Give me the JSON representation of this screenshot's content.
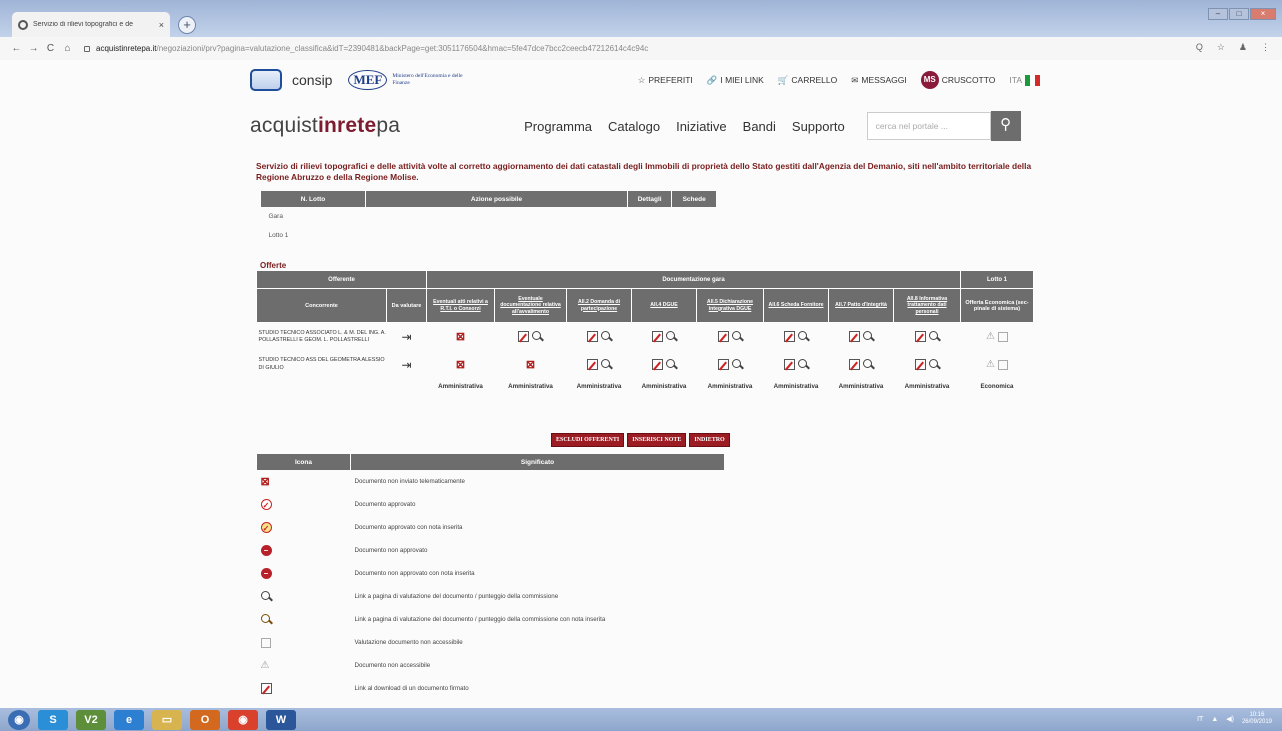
{
  "browser": {
    "tab_title": "Servizio di rilievi topografici e de",
    "tab_close": "×",
    "new_tab": "+",
    "url_host": "acquistinretepa.it",
    "url_path": "/negoziazioni/prv?pagina=valutazione_classifica&idT=2390481&backPage=get:3051176504&hmac=5fe47dce7bcc2ceecb47212614c4c94c",
    "nav_back": "←",
    "nav_forward": "→",
    "nav_reload": "C",
    "nav_home": "⌂",
    "addr_icons": [
      "Q",
      "☆",
      "♟",
      "⋮"
    ]
  },
  "header": {
    "consip": "consip",
    "mef": "MEF",
    "mef_sub": "Ministero dell'Economia e delle Finanze",
    "links": [
      {
        "icon": "☆",
        "label": "PREFERITI"
      },
      {
        "icon": "🔗",
        "label": "I MIEI LINK"
      },
      {
        "icon": "🛒",
        "label": "CARRELLO"
      },
      {
        "icon": "✉",
        "label": "MESSAGGI"
      }
    ],
    "avatar": "MS",
    "cruscotto": "CRUSCOTTO",
    "lang": "ITA"
  },
  "nav": {
    "brand_a": "acquist",
    "brand_b": "inrete",
    "brand_c": "pa",
    "menu": [
      "Programma",
      "Catalogo",
      "Iniziative",
      "Bandi",
      "Supporto"
    ],
    "search_placeholder": "cerca nel portale ..."
  },
  "heading": "Servizio di rilievi topografici e delle attività volte al corretto aggiornamento dei dati catastali degli Immobili di proprietà dello Stato gestiti dall'Agenzia del Demanio, siti nell'ambito territoriale della Regione Abruzzo e della Regione Molise.",
  "lots_table": {
    "headers": [
      "N. Lotto",
      "Azione possibile",
      "Dettagli",
      "Schede"
    ],
    "rows": [
      "Gara",
      "Lotto 1"
    ]
  },
  "offers": {
    "title": "Offerte",
    "group_offerente": "Offerente",
    "group_doc": "Documentazione gara",
    "group_lotto": "Lotto 1",
    "h_concorrente": "Concorrente",
    "h_valutare": "Da valutare",
    "doc_cols": [
      "Eventuali atti relativi a R.T.I. o Consorzi",
      "Eventuale documentazione relativa all'avvalimento",
      "All.2 Domanda di partecipazione",
      "All.4 DGUE",
      "All.5 Dichiarazione integrativa DGUE",
      "All.6 Scheda Fornitore",
      "All.7 Patto d'Integrità",
      "All.8 Informativa trattamento dati personali"
    ],
    "h_economica": "Offerta Economica (sec-pinale di sistema)",
    "rows": [
      {
        "name": "STUDIO TECNICO ASSOCIATO L. & M. DEL ING. A. POLLASTRELLI E GEOM. L. POLLASTRELLI",
        "cells": [
          "nosent",
          "edit",
          "edit",
          "edit",
          "edit",
          "edit",
          "edit",
          "edit"
        ]
      },
      {
        "name": "STUDIO TECNICO ASS DEL GEOMETRA ALESSIO DI GIULIO",
        "cells": [
          "nosent",
          "nosent",
          "edit",
          "edit",
          "edit",
          "edit",
          "edit",
          "edit"
        ]
      }
    ],
    "footer": [
      "Amministrativa",
      "Amministrativa",
      "Amministrativa",
      "Amministrativa",
      "Amministrativa",
      "Amministrativa",
      "Amministrativa",
      "Amministrativa",
      "Economica"
    ]
  },
  "buttons": {
    "escludi": "ESCLUDI OFFERENTI",
    "note": "INSERISCI NOTE",
    "indietro": "INDIETRO"
  },
  "legend": {
    "headers": [
      "Icona",
      "Significato"
    ],
    "rows": [
      {
        "icon": "nosent",
        "text": "Documento non inviato telematicamente"
      },
      {
        "icon": "ok",
        "text": "Documento approvato"
      },
      {
        "icon": "ok-note",
        "text": "Documento approvato con nota inserita"
      },
      {
        "icon": "no",
        "text": "Documento non approvato"
      },
      {
        "icon": "no-note",
        "text": "Documento non approvato con nota inserita"
      },
      {
        "icon": "lens",
        "text": "Link a pagina di valutazione del documento / punteggio della commissione"
      },
      {
        "icon": "lens-note",
        "text": "Link a pagina di valutazione del documento / punteggio della commissione con nota inserita"
      },
      {
        "icon": "lens-faded",
        "text": "Valutazione documento non accessibile"
      },
      {
        "icon": "na",
        "text": "Documento non accessibile"
      },
      {
        "icon": "edit",
        "text": "Link al download di un documento firmato"
      }
    ]
  },
  "taskbar": {
    "apps": [
      "◉",
      "S",
      "V2",
      "e",
      "▭",
      "O",
      "◉",
      "W"
    ],
    "tray_lang": "IT",
    "clock_time": "10:16",
    "clock_date": "26/09/2019"
  }
}
